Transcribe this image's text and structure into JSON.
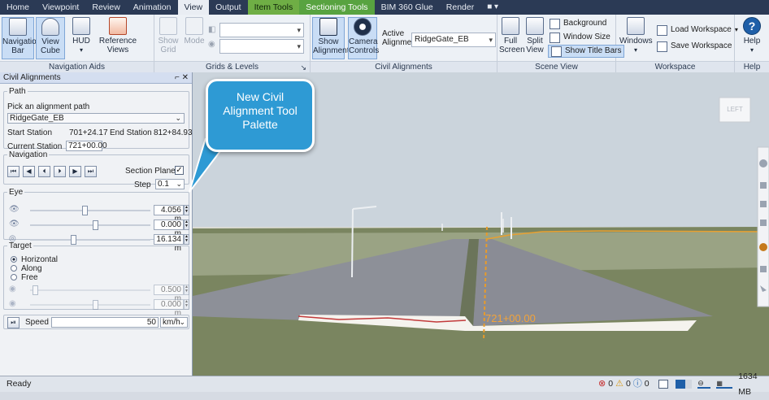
{
  "tabs": [
    "Home",
    "Viewpoint",
    "Review",
    "Animation",
    "View",
    "Output",
    "Item Tools",
    "Sectioning Tools",
    "BIM 360 Glue",
    "Render",
    "■ ▾"
  ],
  "ribbon": {
    "navigation_aids": {
      "label": "Navigation Aids",
      "navigation_bar": "Navigation\nBar",
      "view_cube": "View\nCube",
      "hud": "HUD",
      "reference_views": "Reference\nViews"
    },
    "grids_levels": {
      "label": "Grids & Levels",
      "show_grid": "Show\nGrid",
      "mode": "Mode"
    },
    "civil_alignments": {
      "label": "Civil Alignments",
      "show_alignment": "Show\nAlignment",
      "camera_controls": "Camera\nControls",
      "active_alignment_label": "Active\nAlignment",
      "active_alignment_value": "RidgeGate_EB"
    },
    "scene_view": {
      "label": "Scene View",
      "full_screen": "Full\nScreen",
      "split_view": "Split\nView",
      "background": "Background",
      "window_size": "Window Size",
      "show_title_bars": "Show Title Bars"
    },
    "workspace": {
      "label": "Workspace",
      "windows": "Windows",
      "load_workspace": "Load Workspace",
      "save_workspace": "Save Workspace"
    },
    "help": {
      "label": "Help",
      "help_button": "Help"
    }
  },
  "palette": {
    "title": "Civil Alignments",
    "title_controls": "⌐ ✕",
    "path": {
      "legend": "Path",
      "pick_label": "Pick an alignment path",
      "pick_value": "RidgeGate_EB",
      "start_station_label": "Start Station",
      "start_station_value": "701+24.17",
      "end_station_label": "End Station",
      "end_station_value": "812+84.93",
      "current_station_label": "Current Station",
      "current_station_value": "721+00.00"
    },
    "navigation": {
      "legend": "Navigation",
      "section_plane_label": "Section Plane",
      "section_plane_checked": true,
      "step_label": "Step",
      "step_value": "0.1"
    },
    "eye": {
      "legend": "Eye",
      "values": [
        "4.056 m",
        "0.000 m",
        "16.134 m"
      ],
      "slider_positions": [
        0.45,
        0.54,
        0.36
      ]
    },
    "target": {
      "legend": "Target",
      "options": [
        "Horizontal",
        "Along",
        "Free"
      ],
      "selected": "Horizontal",
      "values": [
        "0.500 m",
        "0.000 m"
      ],
      "slider_positions": [
        0.04,
        0.54
      ]
    },
    "speed": {
      "label": "Speed",
      "value": "50",
      "unit": "km/h"
    }
  },
  "viewport": {
    "station_label": "721+00.00",
    "viewcube_face": "LEFT"
  },
  "callout": {
    "text": "New Civil\nAlignment Tool\nPalette"
  },
  "status": {
    "text": "Ready",
    "error_count": "0",
    "warning_count": "0",
    "info_count": "0",
    "memory": "1634 MB"
  },
  "colors": {
    "tab_bar": "#2b3a55",
    "context_tab_green": "#6fae45",
    "accent_blue": "#2e9ad4",
    "station_label": "#f2a33a",
    "road": "#8a8d97"
  }
}
